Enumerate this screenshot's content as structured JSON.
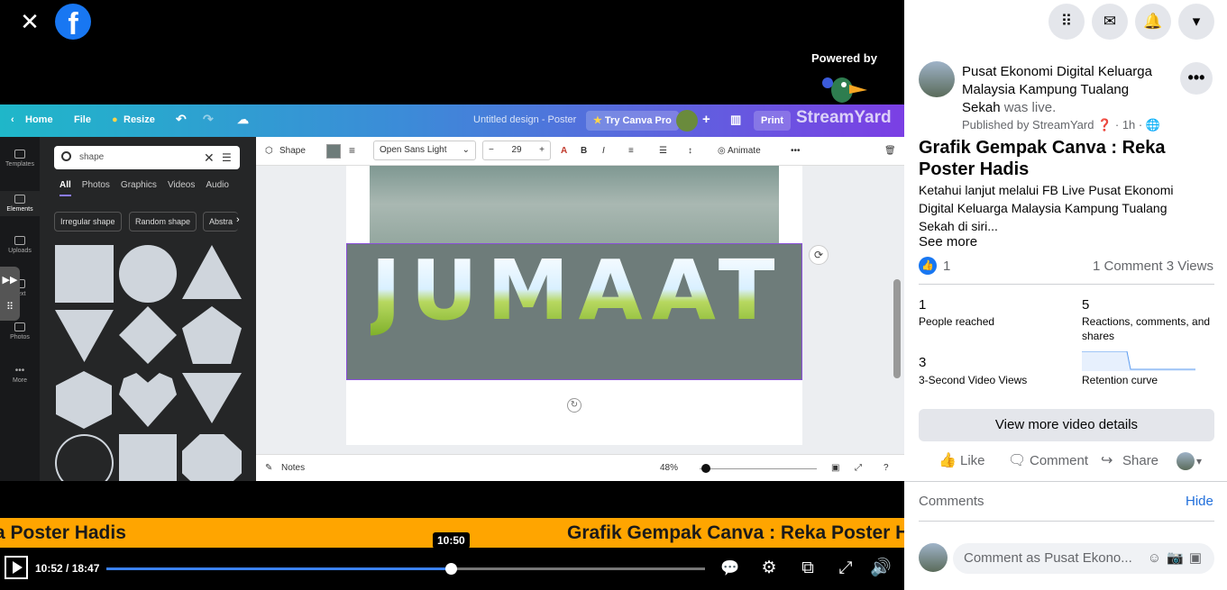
{
  "video": {
    "close_icon": "close-icon",
    "logo_letter": "f",
    "powered_by": "Powered by",
    "streamyard_text": "StreamYard",
    "canva": {
      "home": "Home",
      "file": "File",
      "resize": "Resize",
      "doc_title": "Untitled design - Poster",
      "try_pro": "Try Canva Pro",
      "print": "Print",
      "nav": [
        "Templates",
        "Elements",
        "Uploads",
        "Text",
        "Photos",
        "More"
      ],
      "search_value": "shape",
      "tabs": [
        "All",
        "Photos",
        "Graphics",
        "Videos",
        "Audio"
      ],
      "chips": [
        "Irregular shape",
        "Random shape",
        "Abstra"
      ],
      "shape_label": "Shape",
      "font": "Open Sans Light",
      "font_size": "29",
      "animate": "Animate",
      "canvas_text": "JUMAAT",
      "notes": "Notes",
      "zoom": "48%"
    },
    "ticker_left": "a Poster Hadis",
    "ticker_right": "Grafik Gempak Canva : Reka Poster Hadis",
    "tooltip_time": "10:50",
    "time_display": "10:52 / 18:47",
    "progress_fraction": 0.576
  },
  "sidebar": {
    "page_name": "Pusat Ekonomi Digital Keluarga Malaysia Kampung Tualang Sekah",
    "was_live": "was live.",
    "published": "Published by StreamYard",
    "age": "1h",
    "title": "Grafik Gempak Canva : Reka Poster Hadis",
    "description": "Ketahui lanjut melalui FB Live Pusat Ekonomi Digital Keluarga Malaysia Kampung Tualang Sekah di siri...",
    "see_more": "See more",
    "like_count": "1",
    "comment_count": "1 Comment",
    "views": "3 Views",
    "insights": [
      {
        "num": "1",
        "label": "People reached"
      },
      {
        "num": "5",
        "label": "Reactions, comments, and shares"
      },
      {
        "num": "3",
        "label": "3-Second Video Views"
      },
      {
        "num": "",
        "label": "Retention curve"
      }
    ],
    "view_more": "View more video details",
    "actions": {
      "like": "Like",
      "comment": "Comment",
      "share": "Share"
    },
    "comments_heading": "Comments",
    "hide": "Hide",
    "comment_placeholder": "Comment as Pusat Ekono..."
  },
  "colors": {
    "accent": "#1877f2",
    "ticker": "#ffa500",
    "progress": "#3b82f6"
  }
}
